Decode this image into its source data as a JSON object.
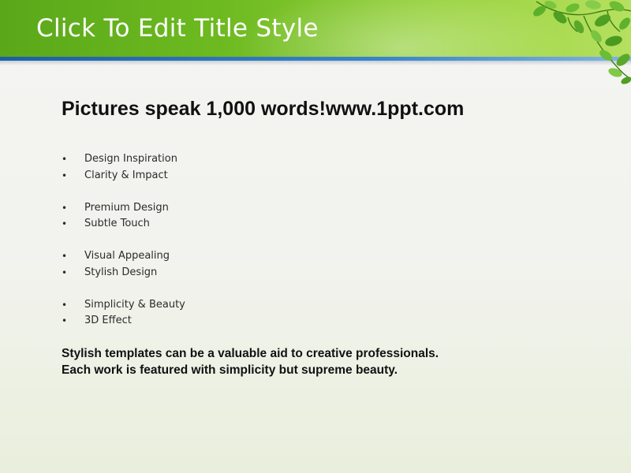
{
  "slide": {
    "title": "Click To Edit Title Style",
    "heading": "Pictures speak 1,000 words!www.1ppt.com",
    "bullet_symbol": "•",
    "bullet_groups": [
      [
        "Design Inspiration",
        "Clarity & Impact"
      ],
      [
        "Premium Design",
        "Subtle Touch"
      ],
      [
        "Visual Appealing",
        "Stylish Design"
      ],
      [
        "Simplicity & Beauty",
        "3D Effect"
      ]
    ],
    "footer_lines": [
      "Stylish templates can be a valuable aid to creative professionals.",
      "Each work is featured with simplicity but supreme beauty."
    ]
  },
  "colors": {
    "title_bar": "#6dba20",
    "title_stripe": "#2f78bf",
    "leaf": "#4e9f22"
  },
  "icons": {
    "decoration": "leaves-icon"
  }
}
